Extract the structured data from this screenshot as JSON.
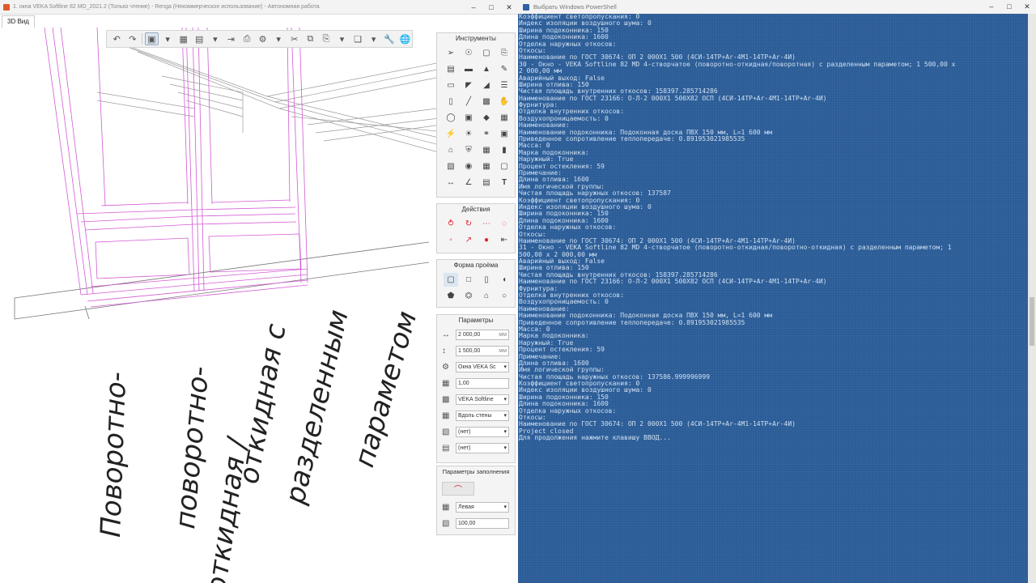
{
  "left_window": {
    "title": "1. окна VEKA Softline 82 MD_2021.2 (Только чтение) - Renga (Некоммерческое использование) - Автономная работа",
    "tab_label": "3D Вид",
    "canvas_text": [
      "Поворотно-",
      "поворотно-",
      "откидная /",
      "откидная с",
      "разделенным",
      "параметом"
    ]
  },
  "panels": {
    "tools": {
      "title": "Инструменты"
    },
    "actions": {
      "title": "Действия"
    },
    "opening_shape": {
      "title": "Форма проёма"
    },
    "params": {
      "title": "Параметры",
      "width_value": "2 000,00",
      "width_unit": "мм",
      "height_value": "1 500,00",
      "height_unit": "мм",
      "style_value": "Окна VEKA Sc",
      "scale_value": "1,00",
      "profile_value": "VEKA Softline",
      "align_value": "Вдоль стены",
      "option1_value": "(нет)",
      "option2_value": "(нет)"
    },
    "fill_params": {
      "title": "Параметры заполнения",
      "side_value": "Левая",
      "percent_value": "100,00"
    }
  },
  "ps_window": {
    "title": "Выбрать Windows PowerShell",
    "lines": [
      "Коэффициент светопропускания: 0",
      "Индекс изоляции воздушного шума: 0",
      "Ширина подоконника: 150",
      "Длина подоконника: 1600",
      "Отделка наружных откосов:",
      "Откосы:",
      "Наименование по ГОСТ 30674: ОП  2 000Х1 500 (4СИ-14ТР+Ar-4М1-14ТР+Ar-4И)",
      "30 - Окно - VEKA Softline 82 MD 4-створчатое (поворотно-откидная/поворотная) с разделенным параметом; 1 500,00 х",
      "2 000,00 мм",
      "Аварийный выход: False",
      "Ширина отлива: 150",
      "Чистая площадь внутренних откосов: 158397.285714286",
      "Наименование по ГОСТ 23166: О-Л-2 000Х1 500Х82 ОСП (4СИ-14ТР+Ar-4М1-14ТР+Ar-4И)",
      "Фурнитура:",
      "Отделка внутренних откосов:",
      "Воздухопроницаемость: 0",
      "Наименование:",
      "Наименование подоконника: Подоконная доска ПВХ 150 мм, L=1 600 мм",
      "Приведенное сопротивление теплопередаче: 0.891953021985535",
      "Масса: 0",
      "Марка подоконника:",
      "Наружный: True",
      "Процент остекления: 59",
      "Примечание:",
      "Длина отлива: 1600",
      "Имя логической группы:",
      "Чистая площадь наружных откосов: 137587",
      "Коэффициент светопропускания: 0",
      "Индекс изоляции воздушного шума: 0",
      "Ширина подоконника: 150",
      "Длина подоконника: 1600",
      "Отделка наружных откосов:",
      "Откосы:",
      "Наименование по ГОСТ 30674: ОП  2 000Х1 500 (4СИ-14ТР+Ar-4М1-14ТР+Ar-4И)",
      "31 - Окно - VEKA Softline 82 MD 4-створчатое (поворотно-откидная/поворотно-откидная) с разделенным параметом; 1",
      "500,00 х 2 000,00 мм",
      "Аварийный выход: False",
      "Ширина отлива: 150",
      "Чистая площадь внутренних откосов: 158397.285714286",
      "Наименование по ГОСТ 23166: О-Л-2 000Х1 500Х82 ОСП (4СИ-14ТР+Ar-4М1-14ТР+Ar-4И)",
      "Фурнитура:",
      "Отделка внутренних откосов:",
      "Воздухопроницаемость: 0",
      "Наименование:",
      "Наименование подоконника: Подоконная доска ПВХ 150 мм, L=1 600 мм",
      "Приведенное сопротивление теплопередаче: 0.891953021985535",
      "Масса: 0",
      "Марка подоконника:",
      "Наружный: True",
      "Процент остекления: 59",
      "Примечание:",
      "Длина отлива: 1600",
      "Имя логической группы:",
      "Чистая площадь наружных откосов: 137586.999996999",
      "Коэффициент светопропускания: 0",
      "Индекс изоляции воздушного шума: 0",
      "Ширина подоконника: 150",
      "Длина подоконника: 1600",
      "Отделка наружных откосов:",
      "Откосы:",
      "Наименование по ГОСТ 30674: ОП  2 000Х1 500 (4СИ-14ТР+Ar-4М1-14ТР+Ar-4И)",
      "Project closed",
      "Для продолжения нажмите клавишу ВВОД..."
    ]
  }
}
